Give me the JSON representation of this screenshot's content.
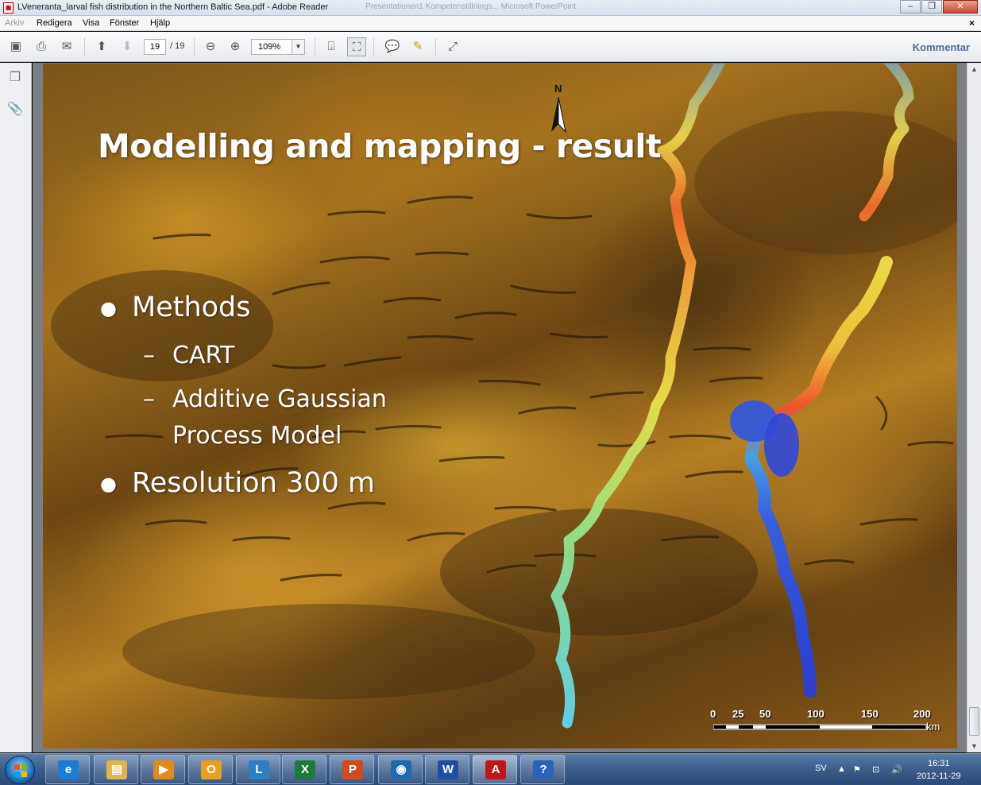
{
  "window": {
    "title": "LVeneranta_larval fish distribution in the Northern Baltic Sea.pdf - Adobe Reader",
    "faded_title": "Presentationen1 Kompetenstillnings... Microsoft PowerPoint"
  },
  "menu": {
    "items": [
      "Arkiv",
      "Redigera",
      "Visa",
      "Fönster",
      "Hjälp"
    ],
    "close": "×"
  },
  "toolbar": {
    "current_page": "19",
    "total_pages": "/ 19",
    "zoom": "109%",
    "comment_label": "Kommentar"
  },
  "slide": {
    "title": "Modelling and mapping - result",
    "bullets": [
      {
        "text": "Methods",
        "sub": [
          "CART",
          "Additive Gaussian",
          "Process Model"
        ]
      },
      {
        "text": "Resolution 300 m"
      }
    ],
    "north_label": "N",
    "scale": {
      "ticks": [
        "0",
        "25",
        "50",
        "100",
        "150",
        "200"
      ],
      "unit": "km"
    }
  },
  "taskbar": {
    "apps": [
      {
        "name": "internet-explorer",
        "label": "e",
        "color": "#1b7bd6"
      },
      {
        "name": "explorer",
        "label": "▤",
        "color": "#e0b54a"
      },
      {
        "name": "media-player",
        "label": "▶",
        "color": "#e08a1a"
      },
      {
        "name": "outlook",
        "label": "O",
        "color": "#e8a020"
      },
      {
        "name": "lync",
        "label": "L",
        "color": "#2d7fc2"
      },
      {
        "name": "excel",
        "label": "X",
        "color": "#1e7a3a"
      },
      {
        "name": "powerpoint",
        "label": "P",
        "color": "#d04a1e"
      },
      {
        "name": "globe-app",
        "label": "◉",
        "color": "#1a6bb0"
      },
      {
        "name": "word",
        "label": "W",
        "color": "#1f4fa3"
      },
      {
        "name": "adobe-reader",
        "label": "A",
        "color": "#c0151a"
      },
      {
        "name": "help",
        "label": "?",
        "color": "#2a64b8"
      }
    ],
    "language": "SV",
    "time": "16:31",
    "date": "2012-11-29"
  },
  "colors": {
    "accent": "#4b6c97",
    "slide_text": "#ffffff"
  }
}
